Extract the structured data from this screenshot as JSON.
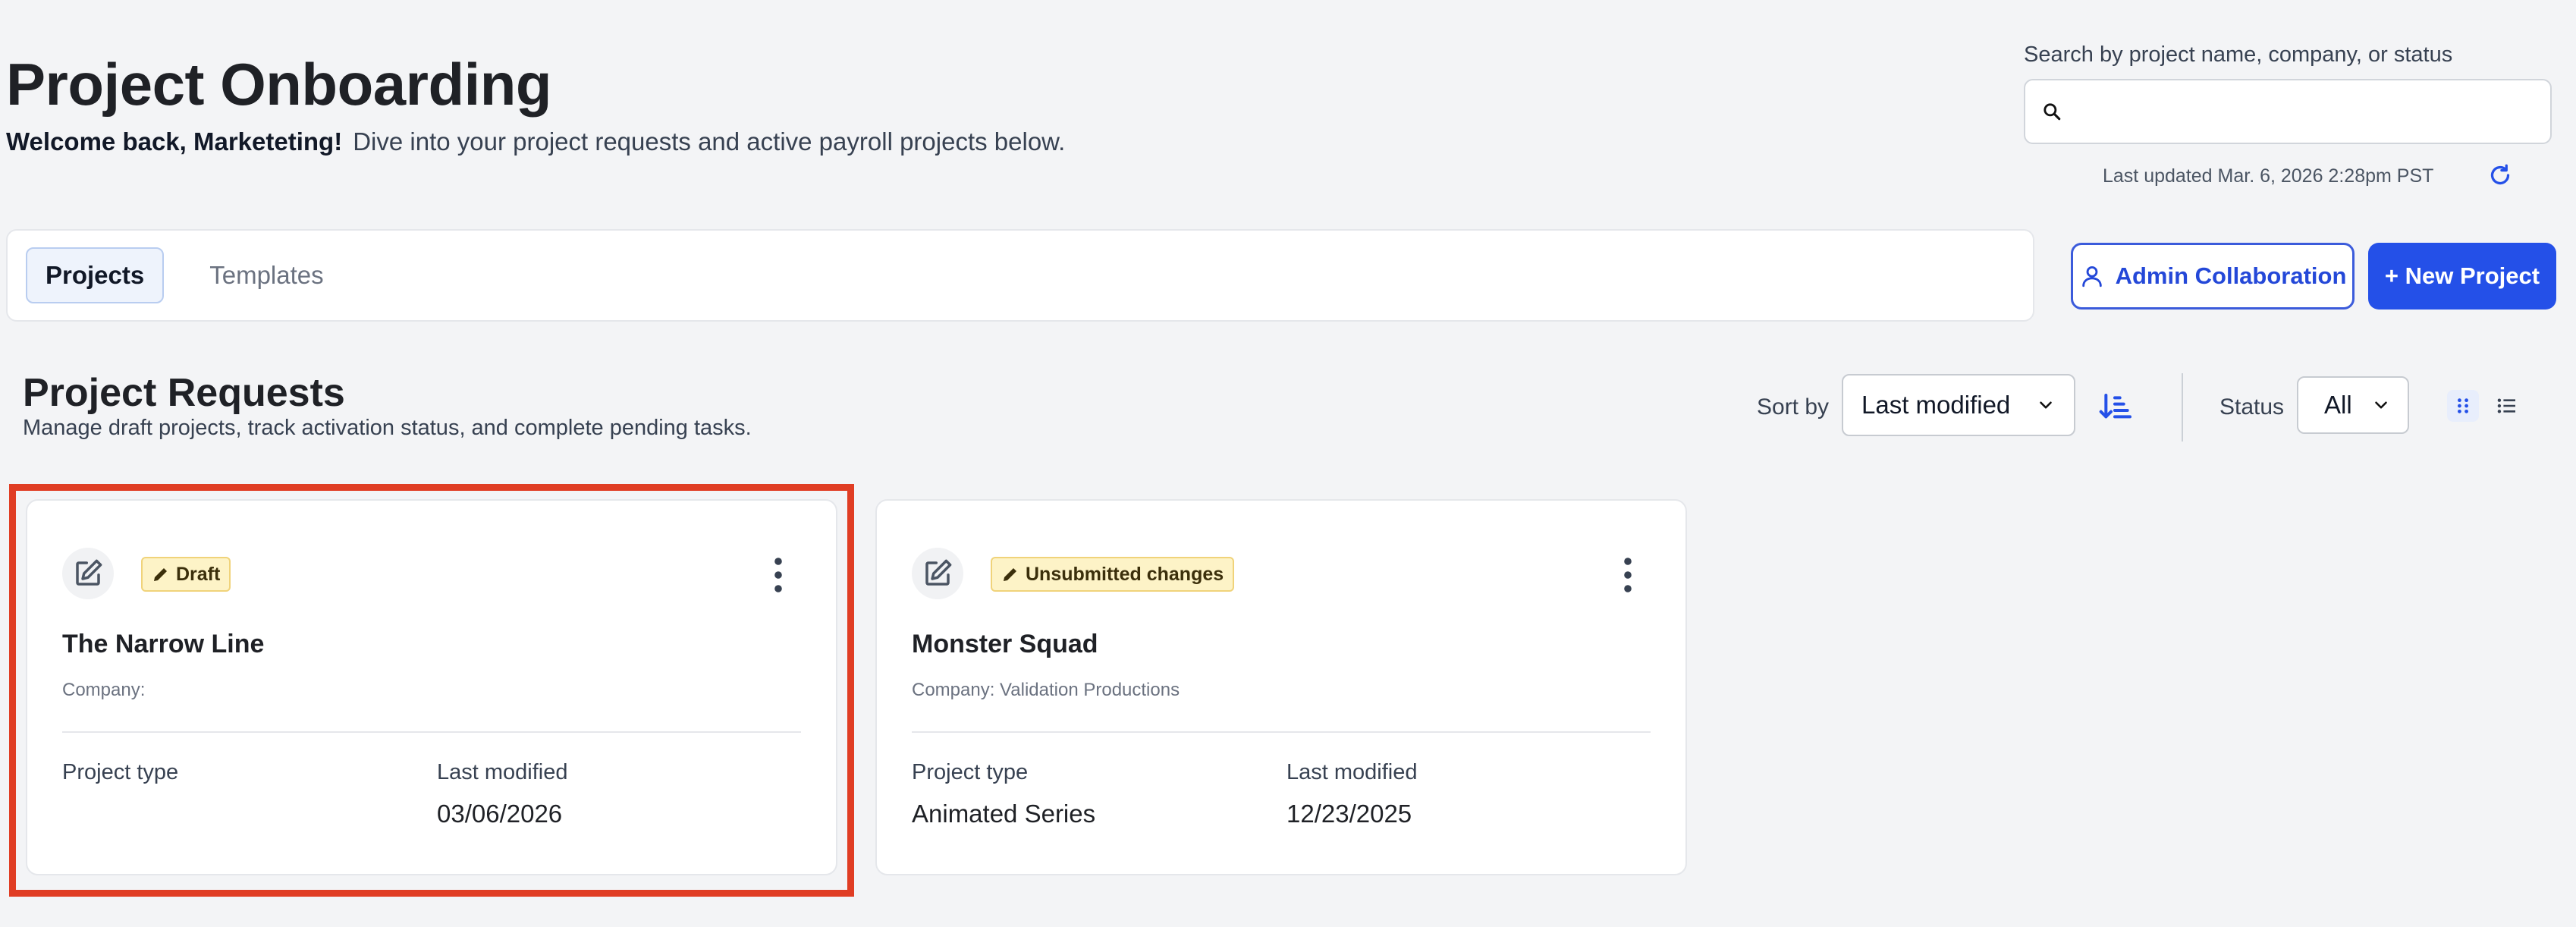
{
  "header": {
    "title": "Project Onboarding",
    "welcome_bold": "Welcome back, Marketeting!",
    "welcome_rest": "Dive into your project requests and active payroll projects below.",
    "search_label": "Search by project name, company, or status",
    "search_value": "",
    "last_updated": "Last updated Mar. 6, 2026 2:28pm PST"
  },
  "tabs": [
    {
      "label": "Projects",
      "active": true
    },
    {
      "label": "Templates",
      "active": false
    }
  ],
  "actions": {
    "admin_collab": "Admin Collaboration",
    "new_project": "+ New Project"
  },
  "section": {
    "title": "Project Requests",
    "subtitle": "Manage draft projects, track activation status, and complete pending tasks.",
    "sort_label": "Sort by",
    "sort_value": "Last modified",
    "status_label": "Status",
    "status_value": "All"
  },
  "cards": [
    {
      "badge": "Draft",
      "title": "The Narrow Line",
      "company": "Company:",
      "type_label": "Project type",
      "type_value": "",
      "modified_label": "Last modified",
      "modified_value": "03/06/2026"
    },
    {
      "badge": "Unsubmitted changes",
      "title": "Monster Squad",
      "company": "Company: Validation Productions",
      "type_label": "Project type",
      "type_value": "Animated Series",
      "modified_label": "Last modified",
      "modified_value": "12/23/2025"
    }
  ],
  "colors": {
    "primary": "#2450e8",
    "highlight": "#e03d24",
    "badge_bg": "#fdf3c7"
  }
}
